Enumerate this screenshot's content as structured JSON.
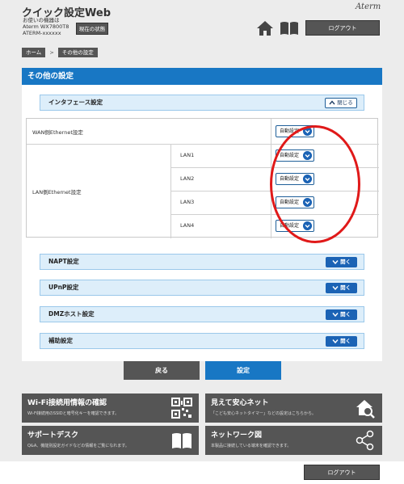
{
  "header": {
    "app_title": "クイック設定Web",
    "model_line1": "お使いの機器は",
    "model_line2": "Aterm WX7800T8",
    "model_line3": "ATERM-xxxxxx",
    "status_button": "現在の状態",
    "brand": "Aterm",
    "logout_button": "ログアウト",
    "home_icon": "home-icon",
    "manual_icon": "book-icon"
  },
  "breadcrumb": {
    "home": "ホーム",
    "separator": ">",
    "current": "その他の設定"
  },
  "page": {
    "title": "その他の設定",
    "accent": "#1877c4"
  },
  "interface_section": {
    "label": "インタフェース設定",
    "toggle": "閉じる",
    "wan_label": "WAN側Ethernet設定",
    "lan_label": "LAN側Ethernet設定",
    "wan_value": "自動設定",
    "lan_ports": [
      {
        "name": "LAN1",
        "value": "自動設定"
      },
      {
        "name": "LAN2",
        "value": "自動設定"
      },
      {
        "name": "LAN3",
        "value": "自動設定"
      },
      {
        "name": "LAN4",
        "value": "自動設定"
      }
    ]
  },
  "sections": [
    {
      "label": "NAPT設定",
      "toggle": "開く"
    },
    {
      "label": "UPnP設定",
      "toggle": "開く"
    },
    {
      "label": "DMZホスト設定",
      "toggle": "開く"
    },
    {
      "label": "補助設定",
      "toggle": "開く"
    }
  ],
  "actions": {
    "back": "戻る",
    "set": "設定"
  },
  "tiles": [
    {
      "title": "Wi-Fi接続用情報の確認",
      "desc": "Wi-Fi接続用のSSIDと暗号化キーを確認できます。",
      "icon": "qr-code-icon"
    },
    {
      "title": "見えて安心ネット",
      "desc": "「こども安心ネットタイマー」などの設定はこちらから。",
      "icon": "house-search-icon"
    },
    {
      "title": "サポートデスク",
      "desc": "Q&A、機能別設定ガイドなどの情報をご覧になれます。",
      "icon": "book-open-icon"
    },
    {
      "title": "ネットワーク図",
      "desc": "本製品に接続している端末を確認できます。",
      "icon": "network-share-icon"
    }
  ],
  "footer": {
    "logout_button": "ログアウト"
  }
}
